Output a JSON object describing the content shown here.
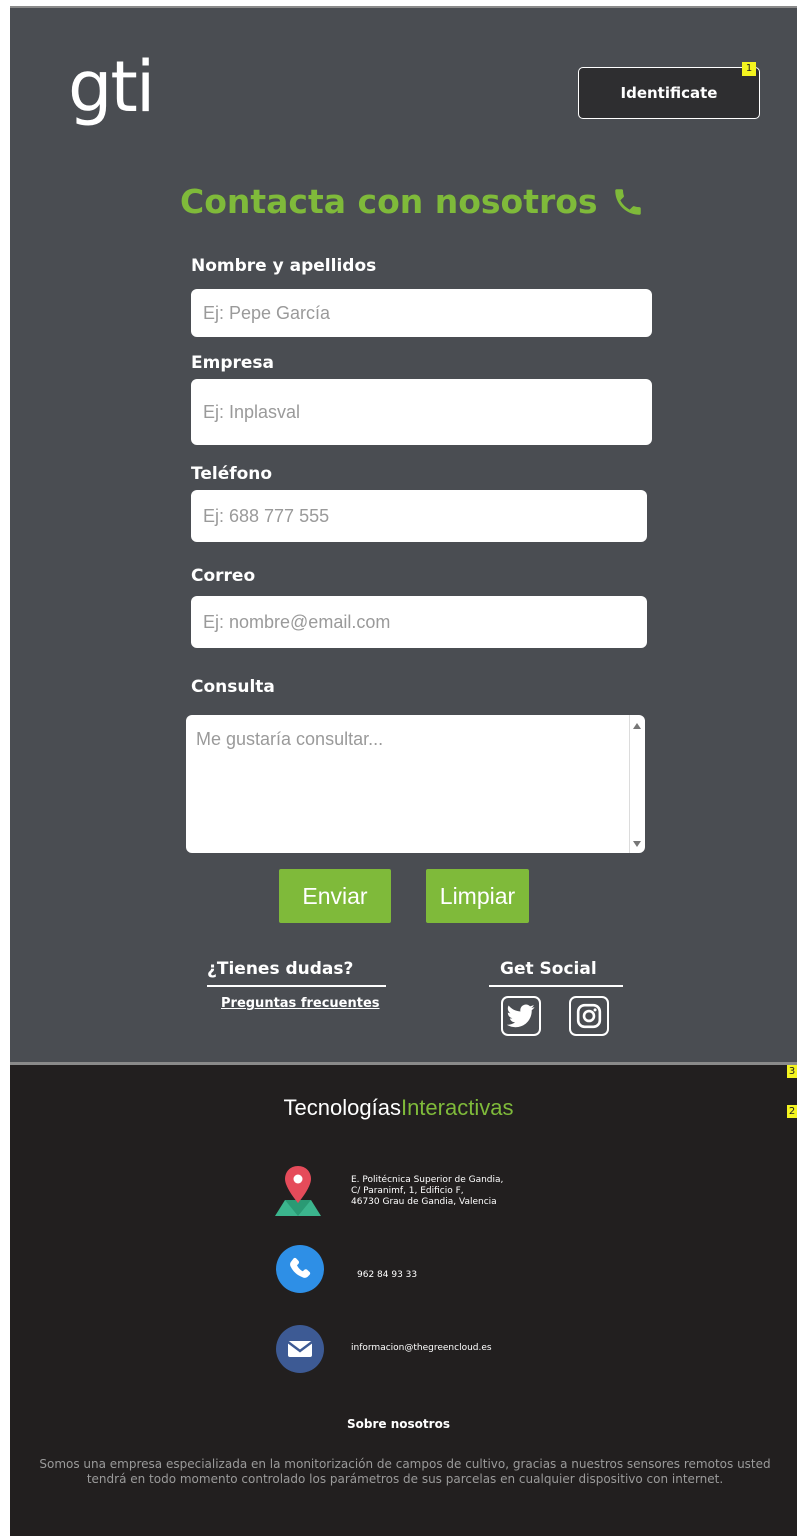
{
  "header": {
    "logo_text": "gti",
    "login_label": "Identificate",
    "badge_1": "1"
  },
  "contact": {
    "title": "Contacta con nosotros",
    "fields": {
      "name_label": "Nombre y apellidos",
      "name_placeholder": "Ej: Pepe García",
      "company_label": "Empresa",
      "company_placeholder": "Ej: Inplasval",
      "phone_label": "Teléfono",
      "phone_placeholder": "Ej: 688 777 555",
      "email_label": "Correo",
      "email_placeholder": "Ej: nombre@email.com",
      "query_label": "Consulta",
      "query_placeholder": "Me gustaría consultar..."
    },
    "submit_label": "Enviar",
    "clear_label": "Limpiar"
  },
  "help": {
    "title": "¿Tienes dudas?",
    "faq_link": "Preguntas frecuentes"
  },
  "social": {
    "title": "Get Social",
    "icons": [
      "twitter-icon",
      "instagram-icon"
    ]
  },
  "footer": {
    "badge_3": "3",
    "badge_2": "2",
    "brand_white": "Tecnologías",
    "brand_green": "Interactivas",
    "address_lines": [
      "E. Politécnica Superior de Gandia,",
      "C/ Paranimf, 1, Edificio F,",
      "46730 Grau de Gandia, Valencia"
    ],
    "phone": "962 84 93 33",
    "email": "informacion@thegreencloud.es",
    "about_title": "Sobre nosotros",
    "about_text": "Somos una empresa especializada en la monitorización de campos de cultivo, gracias a nuestros sensores remotos usted tendrá en todo momento controlado los parámetros de sus parcelas en cualquier dispositivo con internet."
  },
  "colors": {
    "background": "#4a4d52",
    "footer": "#221f1f",
    "accent": "#7fba3a"
  }
}
